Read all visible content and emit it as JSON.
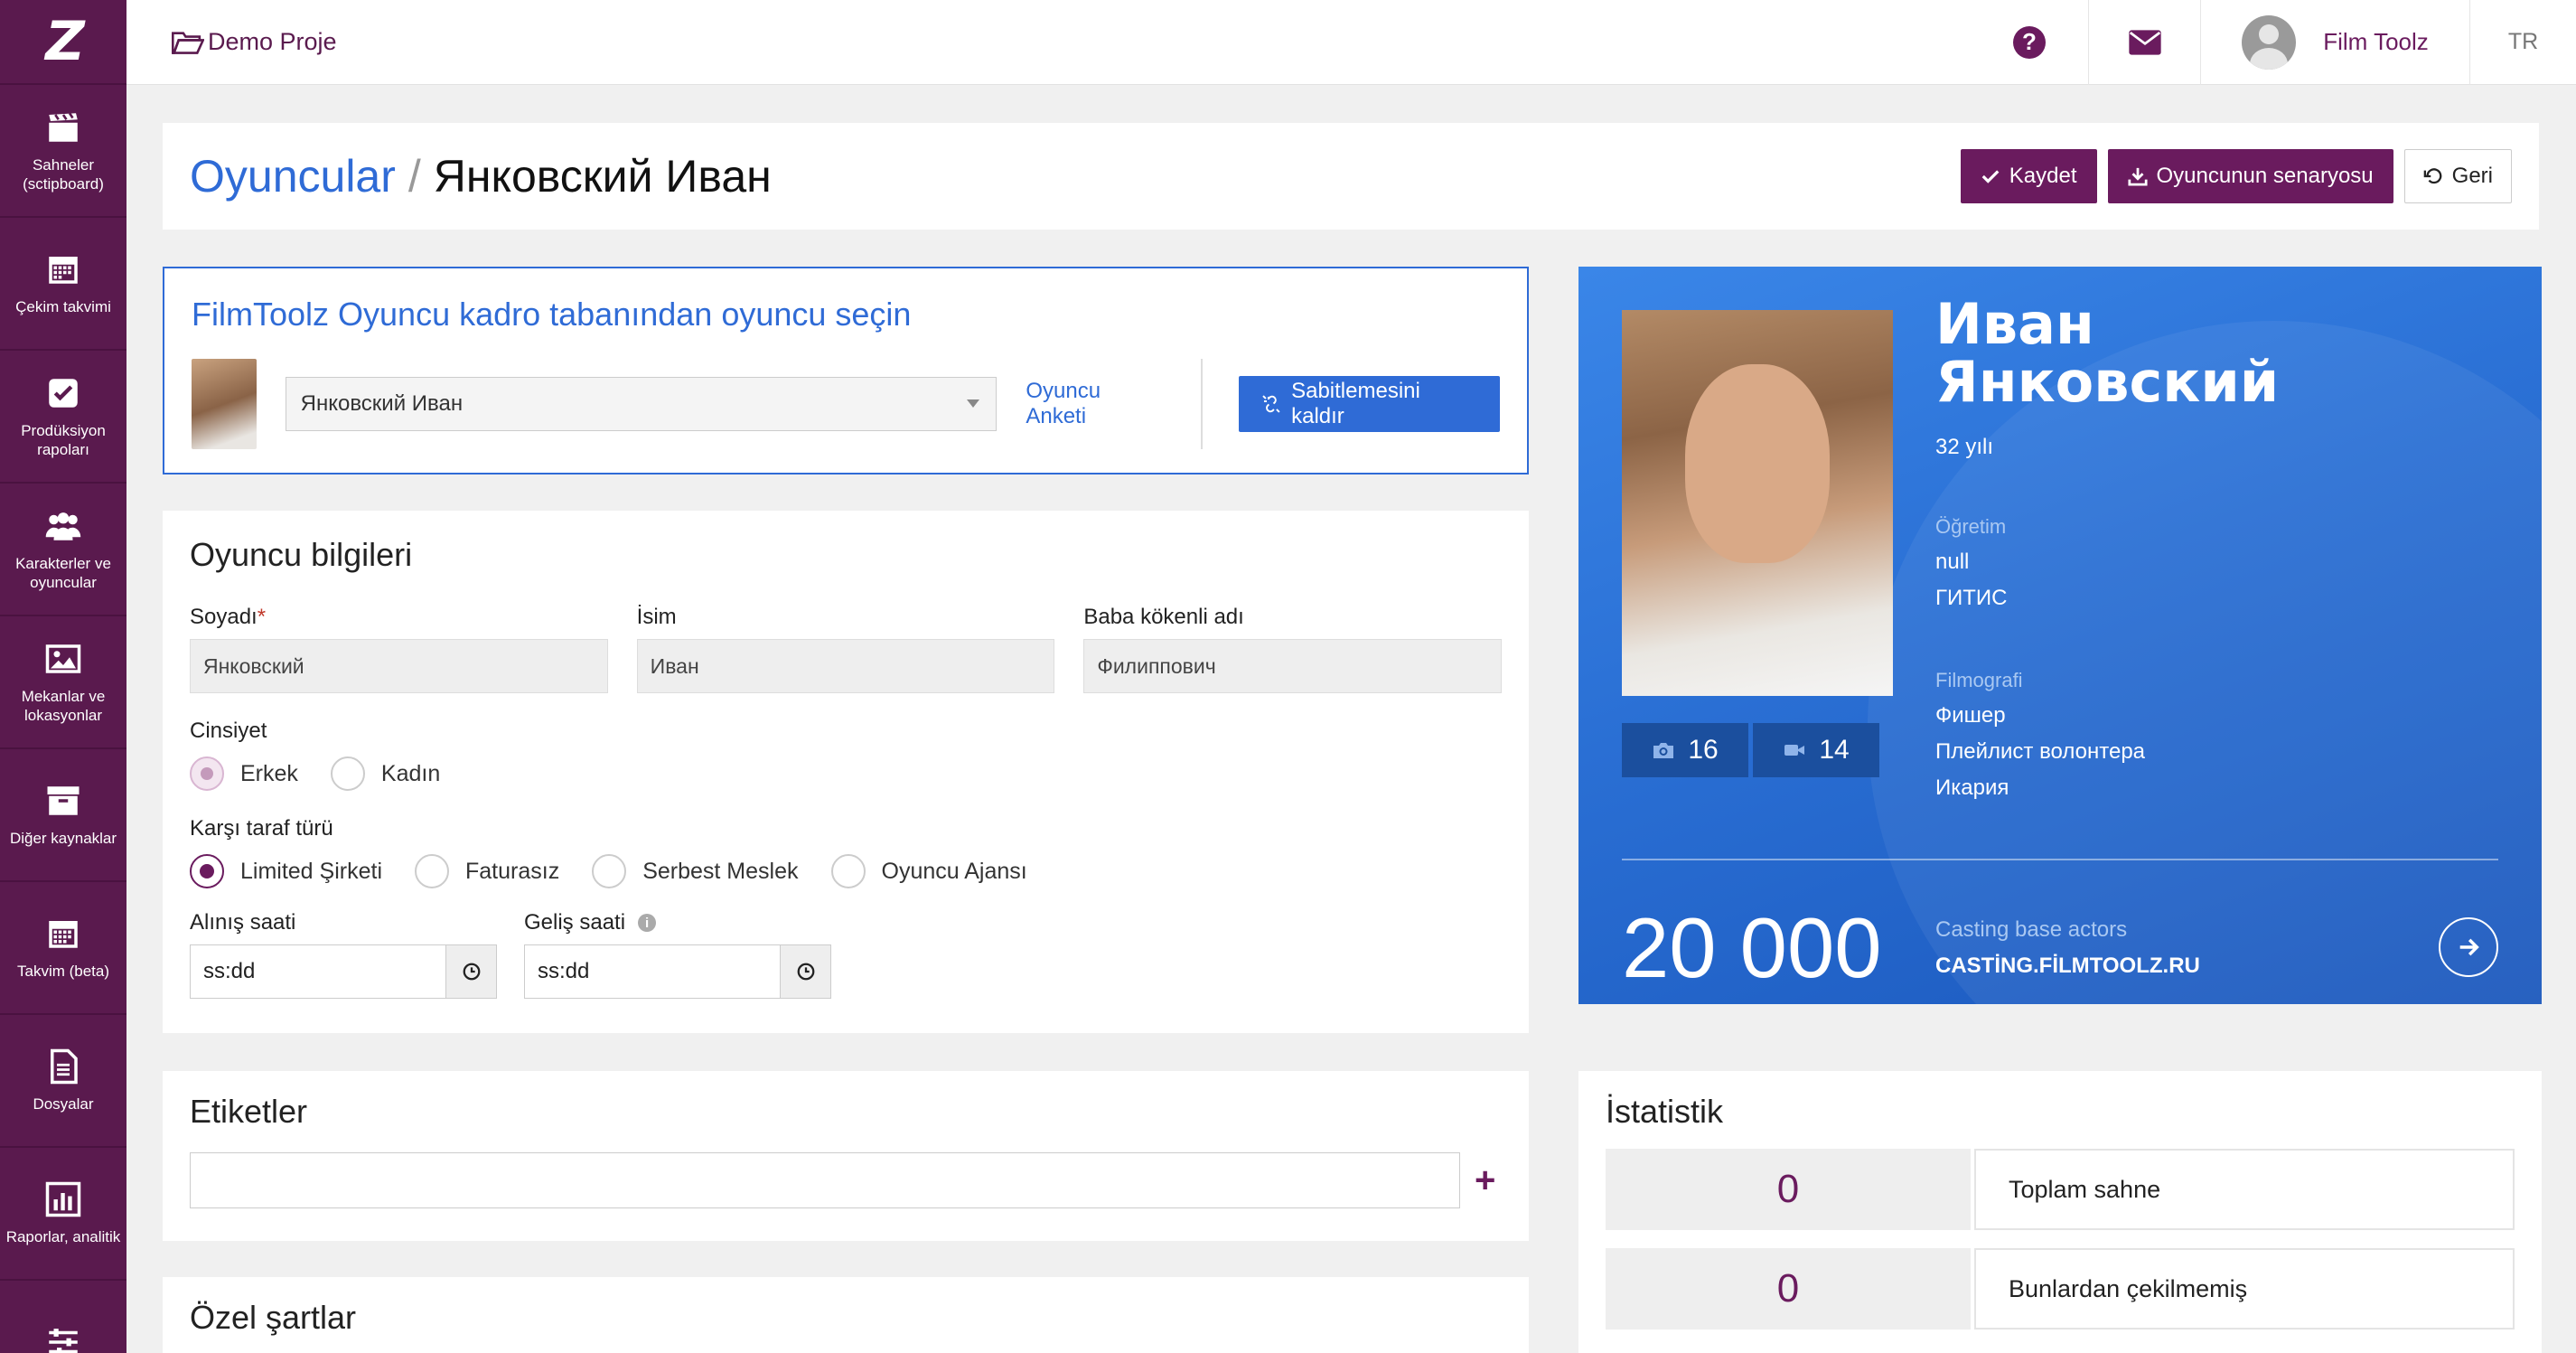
{
  "sidebar": {
    "logo": "Z",
    "items": [
      {
        "label": "Sahneler (sctipboard)",
        "icon": "clapperboard-icon"
      },
      {
        "label": "Çekim takvimi",
        "icon": "calendar-icon"
      },
      {
        "label": "Prodüksiyon rapoları",
        "icon": "checkbox-icon"
      },
      {
        "label": "Karakterler ve oyuncular",
        "icon": "users-icon"
      },
      {
        "label": "Mekanlar ve lokasyonlar",
        "icon": "image-icon"
      },
      {
        "label": "Diğer kaynaklar",
        "icon": "archive-icon"
      },
      {
        "label": "Takvim (beta)",
        "icon": "calendar-grid-icon"
      },
      {
        "label": "Dosyalar",
        "icon": "document-icon"
      },
      {
        "label": "Raporlar, analitik",
        "icon": "bar-chart-icon"
      },
      {
        "label": "",
        "icon": "sliders-icon"
      }
    ]
  },
  "topbar": {
    "project": "Demo Proje",
    "user_name": "Film Toolz",
    "lang": "TR",
    "help_icon": "question-circle-icon",
    "mail_icon": "envelope-icon"
  },
  "header": {
    "crumb_link": "Oyuncular",
    "crumb_sep": "/",
    "crumb_current": "Янковский Иван",
    "save": "Kaydet",
    "scenario": "Oyuncunun senaryosu",
    "back": "Geri"
  },
  "select_card": {
    "title": "FilmToolz Oyuncu kadro tabanından oyuncu seçin",
    "selected": "Янковский Иван",
    "survey_link": "Oyuncu Anketi",
    "unpin": "Sabitlemesini kaldır"
  },
  "form": {
    "title": "Oyuncu bilgileri",
    "surname_label": "Soyadı",
    "surname_required": "*",
    "surname_value": "Янковский",
    "name_label": "İsim",
    "name_value": "Иван",
    "patronymic_label": "Baba kökenli adı",
    "patronymic_value": "Филиппович",
    "gender_label": "Cinsiyet",
    "gender_options": [
      "Erkek",
      "Kadın"
    ],
    "gender_selected": "Erkek",
    "party_label": "Karşı taraf türü",
    "party_options": [
      "Limited Şirketi",
      "Faturasız",
      "Serbest Meslek",
      "Oyuncu Ajansı"
    ],
    "party_selected": "Limited Şirketi",
    "pickup_label": "Alınış saati",
    "pickup_value": "ss:dd",
    "arrival_label": "Geliş saati",
    "arrival_value": "ss:dd"
  },
  "tags": {
    "title": "Etiketler",
    "add": "+"
  },
  "special": {
    "title": "Özel şartlar"
  },
  "profile": {
    "first_name": "Иван",
    "last_name": "Янковский",
    "age": "32 yılı",
    "education_label": "Öğretim",
    "education_1": "null",
    "education_2": "ГИТИС",
    "filmography_label": "Filmografi",
    "films": [
      "Фишер",
      "Плейлист волонтера",
      "Икария"
    ],
    "photos_count": "16",
    "videos_count": "14",
    "base_count": "20 000",
    "base_label": "Casting base actors",
    "base_site": "CASTİNG.FİLMTOOLZ.RU"
  },
  "stats": {
    "title": "İstatistik",
    "rows": [
      {
        "value": "0",
        "label": "Toplam sahne"
      },
      {
        "value": "0",
        "label": "Bunlardan çekilmemiş"
      }
    ]
  },
  "colors": {
    "brand_purple": "#6a1b5e",
    "sidebar": "#5a1a4e",
    "link_blue": "#2f6bd6"
  }
}
